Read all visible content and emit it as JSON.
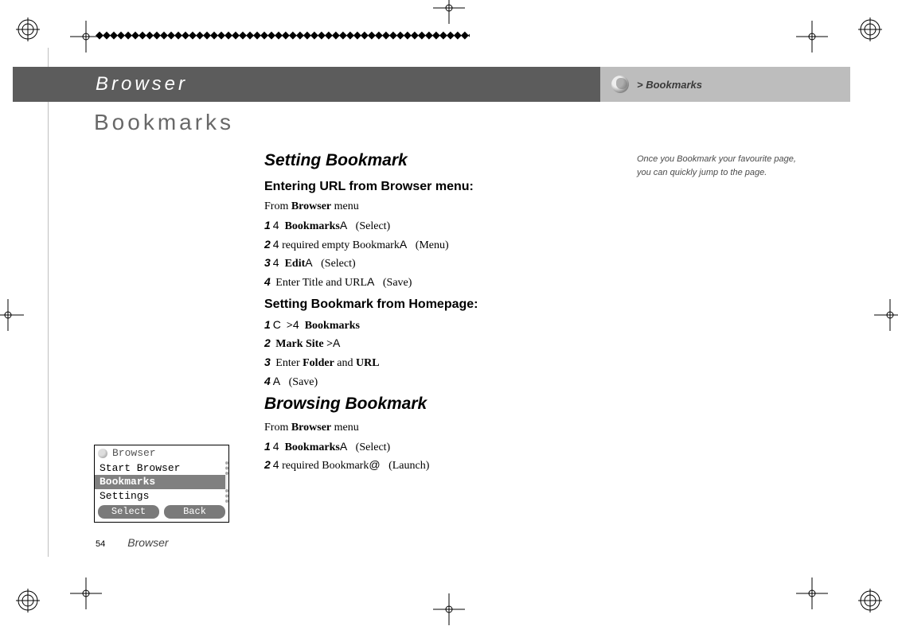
{
  "header": {
    "section": "Browser",
    "crumb": "> Bookmarks"
  },
  "page_title": "Bookmarks",
  "side_note": "Once you Bookmark your favourite page, you can quickly jump to the page.",
  "content": {
    "section1_title": "Setting Bookmark",
    "section1_sub1": "Entering URL from Browser menu:",
    "section1_from": "From ",
    "section1_from_bold": "Browser",
    "section1_from_tail": " menu",
    "s1a_n1": "1",
    "s1a_l1_sym": "4",
    "s1a_l1_bold": "Bookmarks",
    "s1a_l1_tail_sym": "A",
    "s1a_l1_hint": "(Select)",
    "s1a_n2": "2",
    "s1a_l2_sym": "4",
    "s1a_l2_text": " required empty Bookmark",
    "s1a_l2_tail_sym": "A",
    "s1a_l2_hint": "(Menu)",
    "s1a_n3": "3",
    "s1a_l3_sym": "4",
    "s1a_l3_bold": "Edit",
    "s1a_l3_tail_sym": "A",
    "s1a_l3_hint": "(Select)",
    "s1a_n4": "4",
    "s1a_l4_text": " Enter Title and URL",
    "s1a_l4_tail_sym": "A",
    "s1a_l4_hint": "(Save)",
    "section1_sub2": "Setting Bookmark from Homepage:",
    "s1b_n1": "1",
    "s1b_l1_sym1": "C",
    "s1b_l1_gt": ">",
    "s1b_l1_sym2": "4",
    "s1b_l1_bold": "Bookmarks",
    "s1b_n2": "2",
    "s1b_l2_bold": "Mark Site >",
    "s1b_l2_sym": "A",
    "s1b_n3": "3",
    "s1b_l3_pre": " Enter ",
    "s1b_l3_b1": "Folder",
    "s1b_l3_mid": " and ",
    "s1b_l3_b2": "URL",
    "s1b_n4": "4",
    "s1b_l4_sym": "A",
    "s1b_l4_hint": "(Save)",
    "section2_title": "Browsing Bookmark",
    "section2_from": "From ",
    "section2_from_bold": "Browser",
    "section2_from_tail": " menu",
    "s2_n1": "1",
    "s2_l1_sym": "4",
    "s2_l1_bold": "Bookmarks",
    "s2_l1_tail_sym": "A",
    "s2_l1_hint": "(Select)",
    "s2_n2": "2",
    "s2_l2_sym": "4",
    "s2_l2_text": " required Bookmark",
    "s2_l2_tail_sym": "@",
    "s2_l2_hint": "(Launch)"
  },
  "phone": {
    "title": "Browser",
    "row1": "Start Browser",
    "row2": "Bookmarks",
    "row3": "Settings",
    "soft_left": "Select",
    "soft_right": "Back"
  },
  "footer": {
    "page_number": "54",
    "section_label": "Browser"
  },
  "decor": {
    "diamonds": "◆◆◆◆◆◆◆◆◆◆◆◆◆◆◆◆◆◆◆◆◆◆◆◆◆◆◆◆◆◆◆◆◆◆◆◆◆◆◆◆◆◆◆◆◆◆◆◆◆◆◆◆◆◆◆◆"
  }
}
